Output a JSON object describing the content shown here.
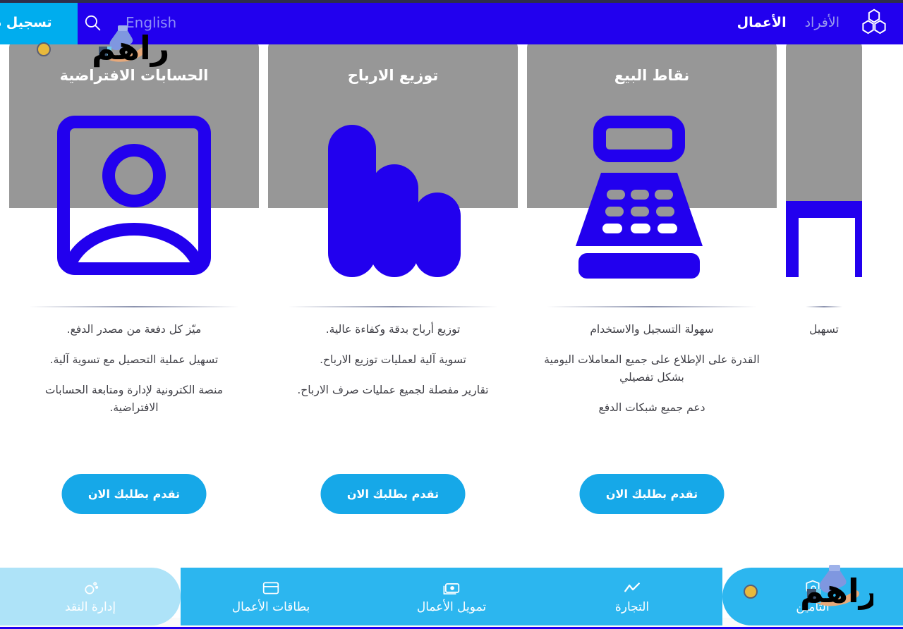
{
  "colors": {
    "header_blue": "#2200ee",
    "cyan": "#00adee",
    "button_blue": "#16a8e8",
    "nav_blue": "#2cb6ef",
    "nav_active": "#aee3f8",
    "card_gray": "#979797",
    "icon_blue": "#2200ee"
  },
  "header": {
    "login_label": "تسجيل د",
    "language_label": "English",
    "search_icon": "search-icon",
    "logo_icon": "al-rajhi-logo-icon",
    "nav": [
      {
        "label": "الأفراد",
        "active": false
      },
      {
        "label": "الأعمال",
        "active": true
      }
    ]
  },
  "cards": [
    {
      "title": "الحسابات الافتراضية",
      "icon": "virtual-account-icon",
      "bullets": [
        "ميّز كل دفعة من مصدر الدفع.",
        "تسهيل عملية التحصيل مع تسوية آلية.",
        "منصة الكترونية لإدارة ومتابعة الحسابات الافتراضية."
      ],
      "button_label": "تقدم بطلبك الان"
    },
    {
      "title": "توزيع الارباح",
      "icon": "bar-chart-icon",
      "bullets": [
        "توزيع أرباح بدقة وكفاءة عالية.",
        "تسوية آلية لعمليات توزيع الارباح.",
        "تقارير مفصلة لجميع عمليات صرف الارباح."
      ],
      "button_label": "تقدم بطلبك الان"
    },
    {
      "title": "نقاط البيع",
      "icon": "pos-terminal-icon",
      "bullets": [
        "سهولة التسجيل والاستخدام",
        "القدرة على الإطلاع على جميع المعاملات اليومية بشكل تفصيلي",
        "دعم جميع شبكات الدفع"
      ],
      "button_label": "تقدم بطلبك الان"
    },
    {
      "title": "",
      "icon": "partial-card-icon",
      "bullets": [
        "تسهيل"
      ],
      "button_label": ""
    }
  ],
  "bottom_nav": [
    {
      "label": "إدارة النقد",
      "icon": "cash-management-icon",
      "active": true
    },
    {
      "label": "بطاقات الأعمال",
      "icon": "business-card-icon",
      "active": false
    },
    {
      "label": "تمويل الأعمال",
      "icon": "business-finance-icon",
      "active": false
    },
    {
      "label": "التجارة",
      "icon": "trade-trendline-icon",
      "active": false
    },
    {
      "label": "التأمين",
      "icon": "insurance-shield-icon",
      "active": false
    }
  ],
  "watermark": {
    "text": "دراهم",
    "icon": "money-bag-on-hand-icon"
  }
}
